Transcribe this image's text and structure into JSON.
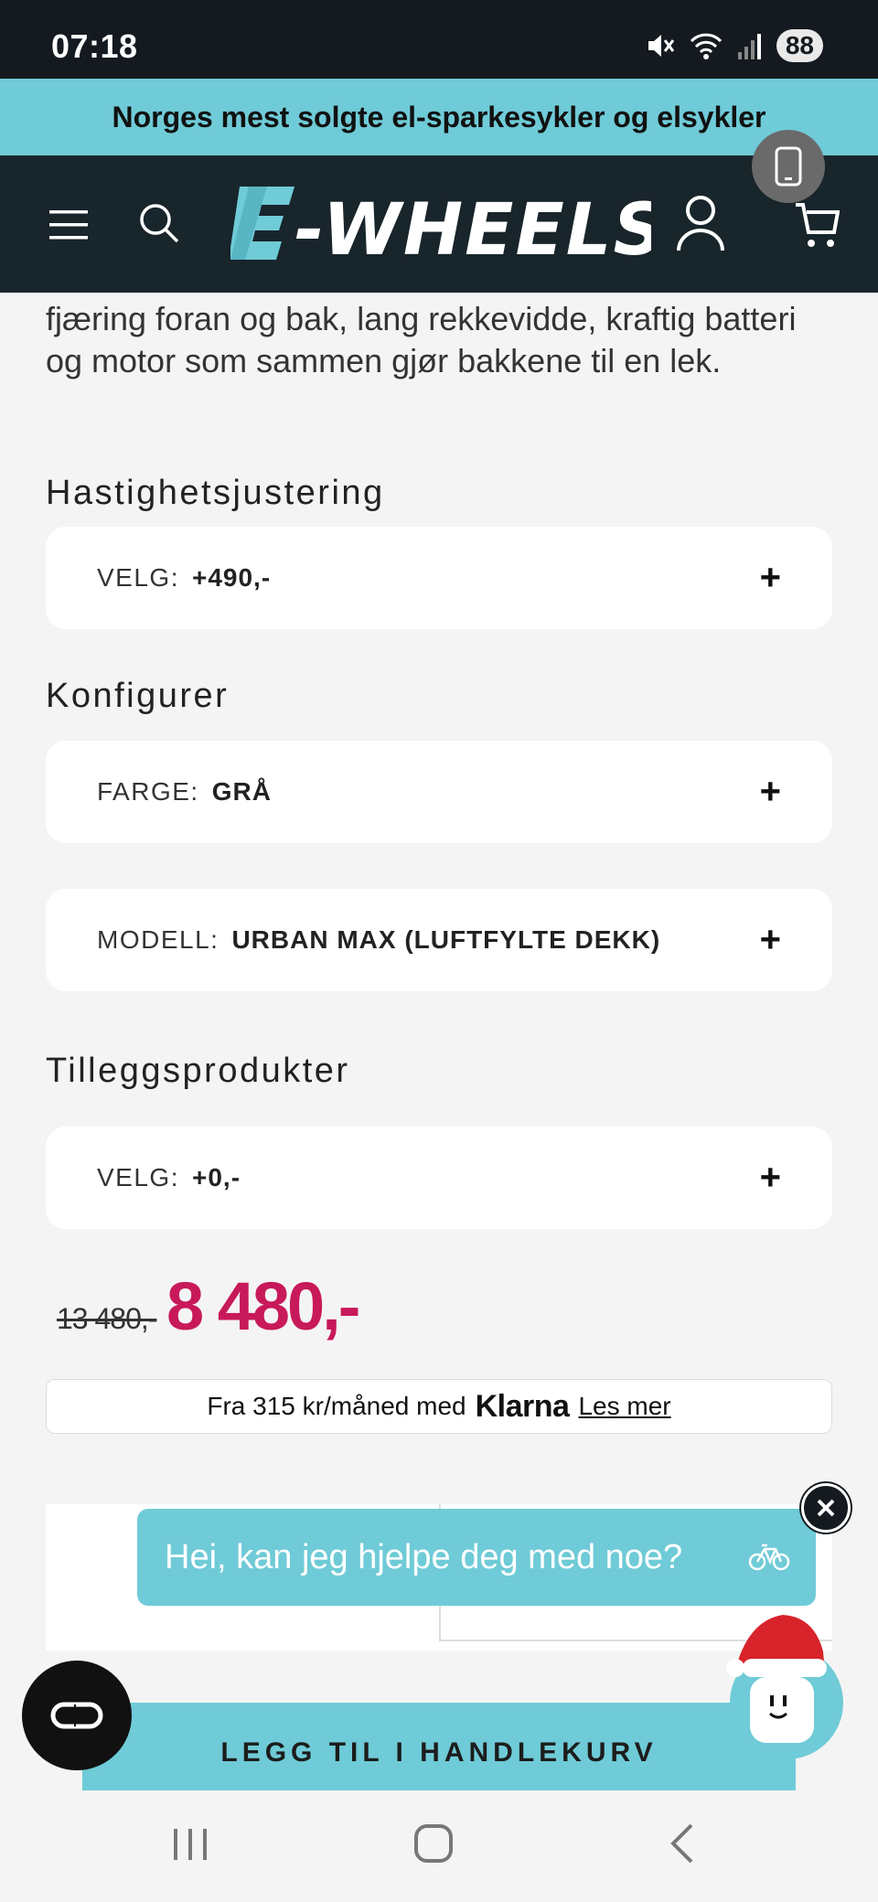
{
  "status_bar": {
    "time": "07:18",
    "battery": "88"
  },
  "promo": {
    "text": "Norges mest solgte el-sparkesykler og elsykler"
  },
  "header": {
    "logo_text": "E-WHEELS"
  },
  "product": {
    "description": "fjæring foran og bak, lang rekkevidde, kraftig batteri og motor som sammen gjør bakkene til en lek.",
    "sections": {
      "speed": {
        "heading": "Hastighetsjustering",
        "option_label": "VELG:",
        "option_value": "+490,-"
      },
      "configure": {
        "heading": "Konfigurer",
        "color_label": "FARGE:",
        "color_value": "GRÅ",
        "model_label": "MODELL:",
        "model_value": "URBAN MAX (LUFTFYLTE DEKK)"
      },
      "addons": {
        "heading": "Tilleggsprodukter",
        "option_label": "VELG:",
        "option_value": "+0,-"
      }
    },
    "plus_symbol": "+",
    "price_old": "13 480,-",
    "price_new": "8 480,-",
    "klarna": {
      "text": "Fra 315 kr/måned med",
      "brand": "Klarna",
      "link": "Les mer"
    },
    "add_to_cart": "LEGG TIL I HANDLEKURV"
  },
  "chat": {
    "message": "Hei, kan jeg hjelpe deg med noe?"
  },
  "colors": {
    "accent": "#6fcbd7",
    "header": "#18252b",
    "price": "#c8195a"
  }
}
